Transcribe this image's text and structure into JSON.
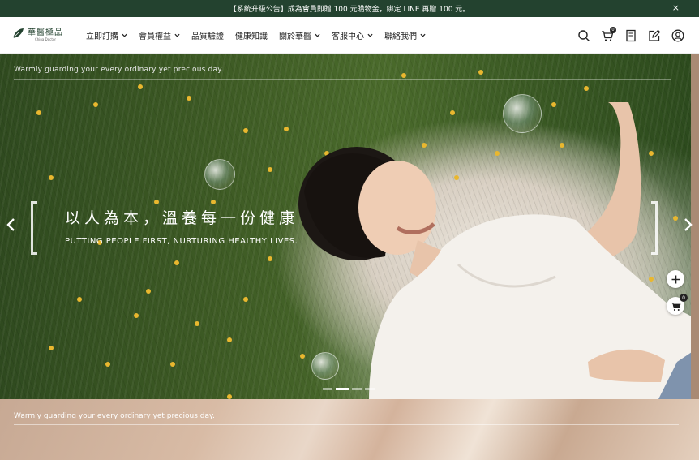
{
  "announcement": {
    "text": "【系統升級公告】成為會員即贈 100 元購物金，綁定 LINE 再贈 100 元。",
    "close_glyph": "×"
  },
  "logo": {
    "name": "華醫極品",
    "sub": "China Doctor"
  },
  "nav": [
    {
      "label": "立即訂購",
      "has_dropdown": true
    },
    {
      "label": "會員權益",
      "has_dropdown": true
    },
    {
      "label": "品質驗證",
      "has_dropdown": false
    },
    {
      "label": "健康知識",
      "has_dropdown": false
    },
    {
      "label": "關於華醫",
      "has_dropdown": true
    },
    {
      "label": "客服中心",
      "has_dropdown": true
    },
    {
      "label": "聯絡我們",
      "has_dropdown": true
    }
  ],
  "tools": {
    "cart_count": "0"
  },
  "hero": {
    "tagline": "Warmly guarding your every ordinary yet precious day.",
    "title": "以人為本，溫養每一份健康",
    "subtitle": "PUTTING PEOPLE FIRST, NURTURING HEALTHY LIVES.",
    "slide_count": 4,
    "active_slide": 2
  },
  "floating": {
    "cart_count": "0"
  },
  "section2": {
    "tagline": "Warmly guarding your every ordinary yet precious day."
  },
  "colors": {
    "brand": "#23422f",
    "accent": "#e9b72f"
  },
  "icons": [
    "close-icon",
    "leaf-logo-icon",
    "chevron-down-icon",
    "search-icon",
    "cart-icon",
    "book-icon",
    "edit-icon",
    "user-icon",
    "chevron-left-icon",
    "chevron-right-icon",
    "plus-icon"
  ]
}
